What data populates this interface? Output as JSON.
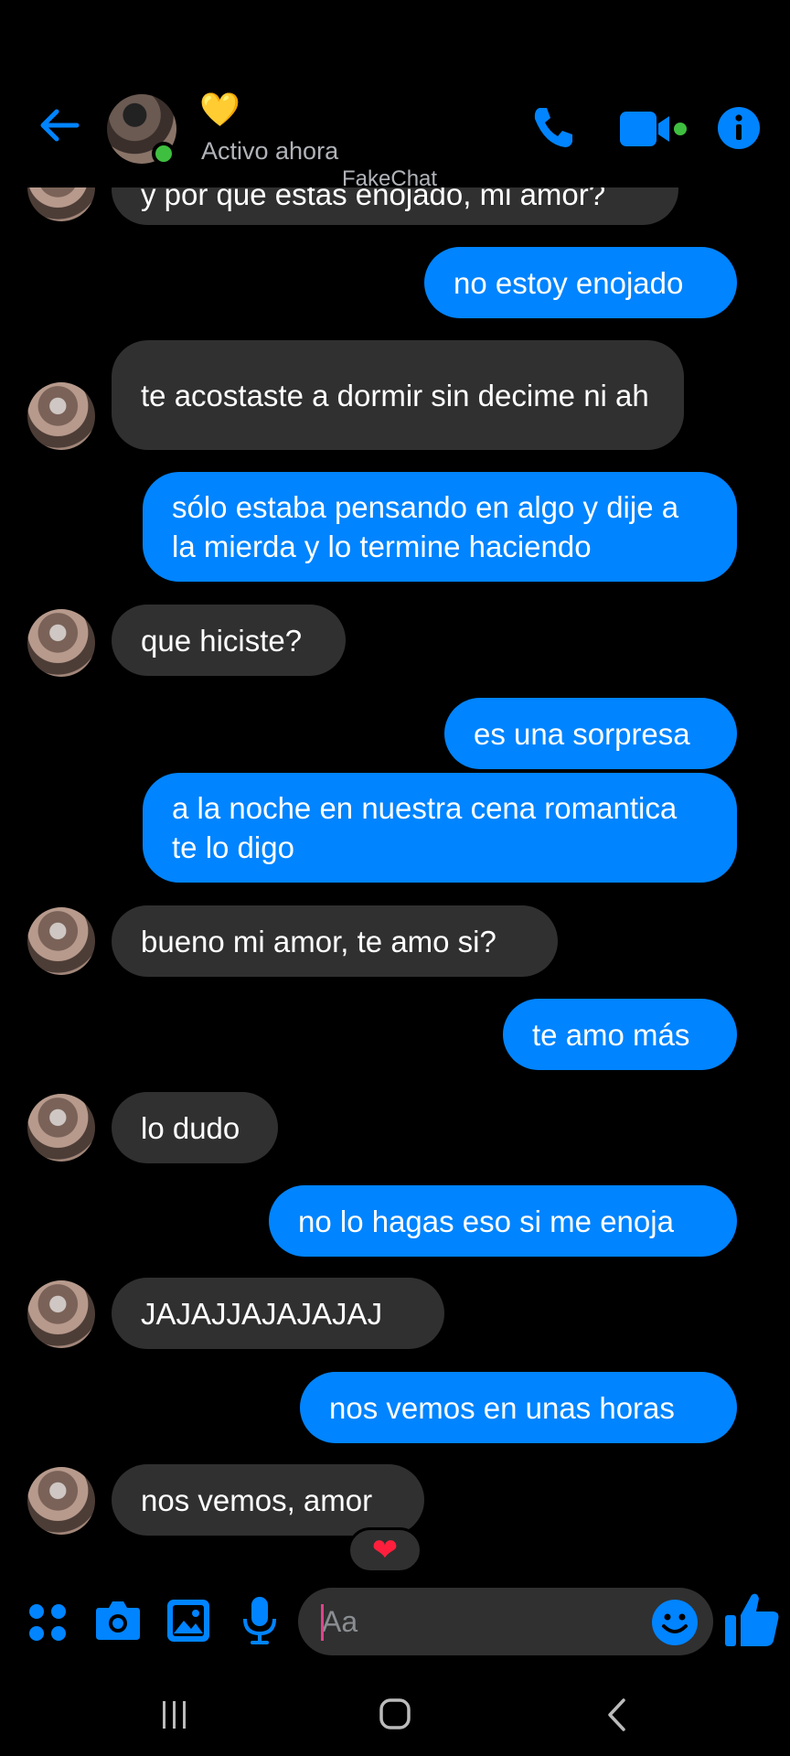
{
  "contact": {
    "name": "💛",
    "status": "Activo ahora"
  },
  "watermark": "FakeChat",
  "messages": [
    {
      "dir": "in",
      "text": "y por que estas enojado, mi amor?"
    },
    {
      "dir": "out",
      "text": "no estoy enojado"
    },
    {
      "dir": "in",
      "text": "te acostaste a dormir sin decime ni ah"
    },
    {
      "dir": "out",
      "text": "sólo estaba pensando en algo y dije a la mierda y lo termine haciendo"
    },
    {
      "dir": "in",
      "text": "que hiciste?"
    },
    {
      "dir": "out",
      "text": "es una sorpresa"
    },
    {
      "dir": "out",
      "text": "a la noche en nuestra cena romantica te lo digo"
    },
    {
      "dir": "in",
      "text": "bueno mi amor, te amo si?"
    },
    {
      "dir": "out",
      "text": "te amo más"
    },
    {
      "dir": "in",
      "text": "lo dudo"
    },
    {
      "dir": "out",
      "text": "no lo hagas eso si me enoja"
    },
    {
      "dir": "in",
      "text": "JAJAJJAJAJAJAJ"
    },
    {
      "dir": "out",
      "text": "nos vemos en unas horas"
    },
    {
      "dir": "in",
      "text": "nos vemos, amor"
    }
  ],
  "reaction": "❤",
  "composer": {
    "placeholder": "Aa"
  },
  "icons": {
    "back": "arrow-left-icon",
    "call": "phone-icon",
    "video": "video-camera-icon",
    "info": "info-icon",
    "apps": "four-dots-icon",
    "camera": "camera-icon",
    "gallery": "image-icon",
    "mic": "microphone-icon",
    "emoji": "smiley-icon",
    "like": "thumbs-up-icon"
  },
  "colors": {
    "accent": "#0084ff",
    "incoming": "#303030",
    "background": "#000000",
    "online": "#3fbf3f"
  }
}
